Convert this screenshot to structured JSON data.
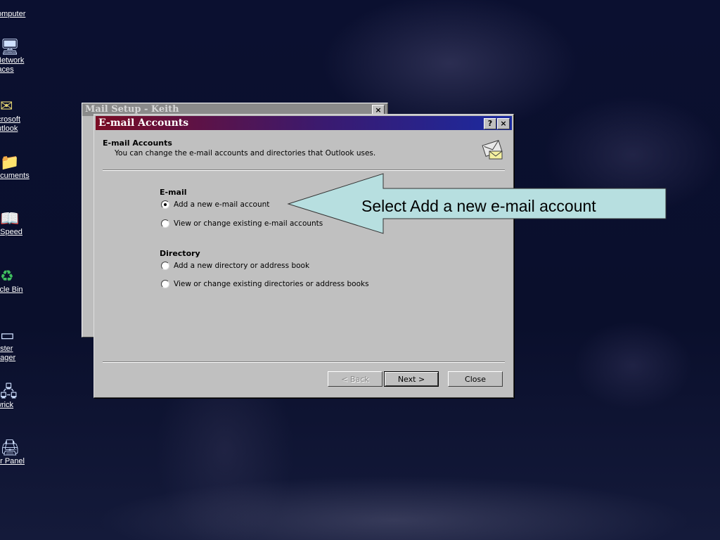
{
  "desktop": {
    "icons": [
      {
        "name": "my-computer-icon",
        "label": "omputer"
      },
      {
        "name": "network-places-icon",
        "label": "Network\nlaces"
      },
      {
        "name": "outlook-icon",
        "label": "crosoft\nutlook"
      },
      {
        "name": "documents-icon",
        "label": "ocuments"
      },
      {
        "name": "speed-icon",
        "label": "eSpeed"
      },
      {
        "name": "recycle-bin-icon",
        "label": "ycle Bin"
      },
      {
        "name": "poster-manager-icon",
        "label": "oster\nnager"
      },
      {
        "name": "wrick-icon",
        "label": "wrick"
      },
      {
        "name": "control-panel-icon",
        "label": "er Panel"
      }
    ]
  },
  "back_dialog": {
    "title": "Mail Setup - Keith",
    "close_label": "×"
  },
  "dialog": {
    "title": "E-mail Accounts",
    "help_label": "?",
    "close_label": "×",
    "header_title": "E-mail Accounts",
    "header_subtitle": "You can change the e-mail accounts and directories that Outlook uses.",
    "email_section": {
      "title": "E-mail",
      "options": [
        {
          "label": "Add a new e-mail account",
          "selected": true
        },
        {
          "label": "View or change existing e-mail accounts",
          "selected": false
        }
      ]
    },
    "directory_section": {
      "title": "Directory",
      "options": [
        {
          "label": "Add a new directory or address book",
          "selected": false
        },
        {
          "label": "View or change existing directories or address books",
          "selected": false
        }
      ]
    },
    "buttons": {
      "back": "< Back",
      "next": "Next >",
      "close": "Close"
    }
  },
  "callout": {
    "text": "Select Add a new e-mail account",
    "color": "#b7dfe0"
  }
}
